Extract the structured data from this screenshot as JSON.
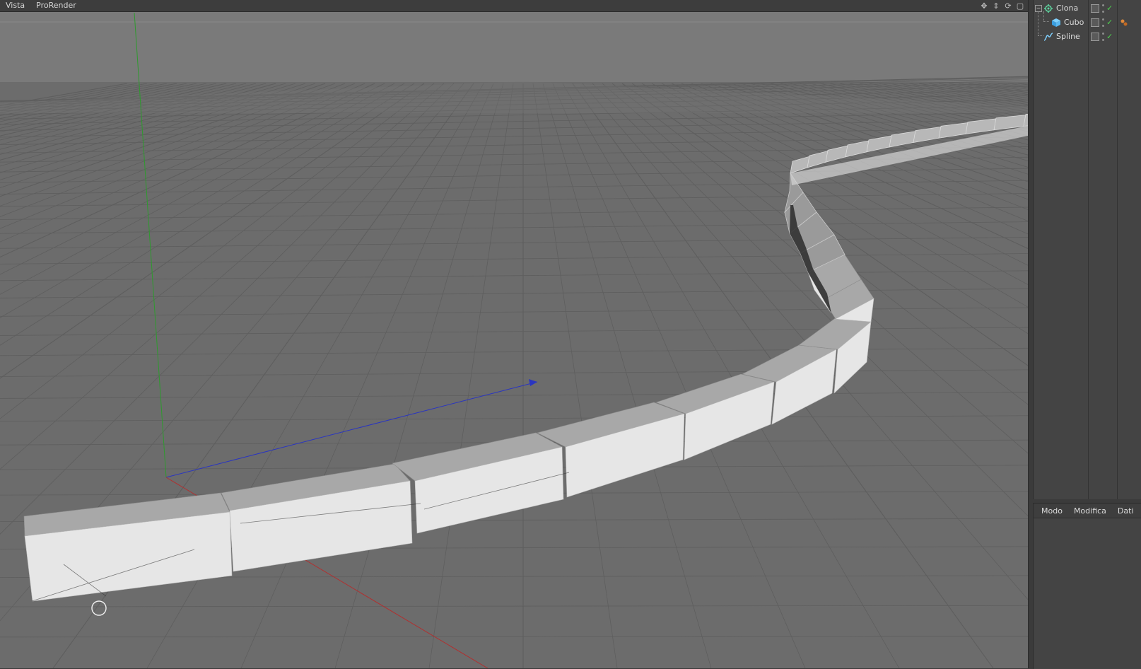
{
  "menubar": {
    "items": [
      "Vista",
      "ProRender"
    ]
  },
  "nav_icons": [
    "move-view-icon",
    "zoom-view-icon",
    "rotate-view-icon",
    "maximize-view-icon"
  ],
  "object_manager": {
    "objects": [
      {
        "name": "Clona",
        "icon": "cloner-icon",
        "level": 0
      },
      {
        "name": "Cubo",
        "icon": "cube-icon",
        "level": 1
      },
      {
        "name": "Spline",
        "icon": "spline-icon",
        "level": 0
      }
    ]
  },
  "attribute_manager": {
    "tabs": [
      "Modo",
      "Modifica",
      "Dati"
    ]
  },
  "colors": {
    "viewport_bg": "#6d6d6d",
    "grid_line": "#5a5a5a",
    "axis_x": "#b03030",
    "axis_y": "#2e9a2e",
    "axis_z": "#2a35c0",
    "cube_face": "#e6e6e6",
    "cube_top": "#a8a8a8",
    "check_green": "#4fd04f"
  }
}
